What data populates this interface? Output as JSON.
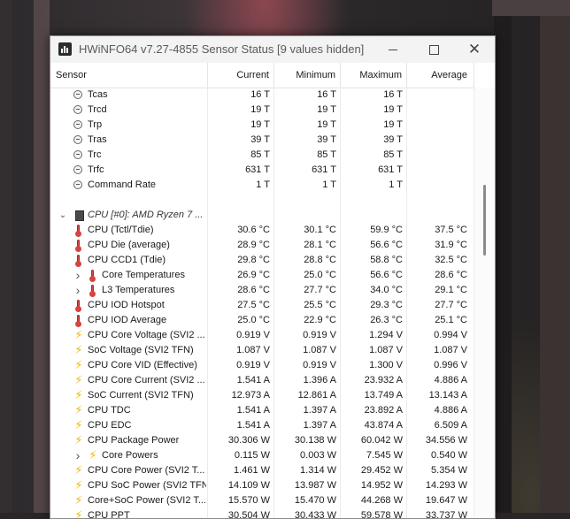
{
  "window": {
    "title": "HWiNFO64 v7.27-4855 Sensor Status [9 values hidden]"
  },
  "columns": {
    "sensor": "Sensor",
    "current": "Current",
    "minimum": "Minimum",
    "maximum": "Maximum",
    "average": "Average"
  },
  "rows": [
    {
      "type": "timing",
      "name": "Tcas",
      "cur": "16 T",
      "min": "16 T",
      "max": "16 T",
      "avg": ""
    },
    {
      "type": "timing",
      "name": "Trcd",
      "cur": "19 T",
      "min": "19 T",
      "max": "19 T",
      "avg": ""
    },
    {
      "type": "timing",
      "name": "Trp",
      "cur": "19 T",
      "min": "19 T",
      "max": "19 T",
      "avg": ""
    },
    {
      "type": "timing",
      "name": "Tras",
      "cur": "39 T",
      "min": "39 T",
      "max": "39 T",
      "avg": ""
    },
    {
      "type": "timing",
      "name": "Trc",
      "cur": "85 T",
      "min": "85 T",
      "max": "85 T",
      "avg": ""
    },
    {
      "type": "timing",
      "name": "Trfc",
      "cur": "631 T",
      "min": "631 T",
      "max": "631 T",
      "avg": ""
    },
    {
      "type": "timing",
      "name": "Command Rate",
      "cur": "1 T",
      "min": "1 T",
      "max": "1 T",
      "avg": ""
    },
    {
      "type": "blank",
      "name": "",
      "cur": "",
      "min": "",
      "max": "",
      "avg": ""
    },
    {
      "type": "group",
      "name": "CPU [#0]: AMD Ryzen 7 ...",
      "cur": "",
      "min": "",
      "max": "",
      "avg": ""
    },
    {
      "type": "temp",
      "name": "CPU (Tctl/Tdie)",
      "cur": "30.6 °C",
      "min": "30.1 °C",
      "max": "59.9 °C",
      "avg": "37.5 °C"
    },
    {
      "type": "temp",
      "name": "CPU Die (average)",
      "cur": "28.9 °C",
      "min": "28.1 °C",
      "max": "56.6 °C",
      "avg": "31.9 °C"
    },
    {
      "type": "temp",
      "name": "CPU CCD1 (Tdie)",
      "cur": "29.8 °C",
      "min": "28.8 °C",
      "max": "58.8 °C",
      "avg": "32.5 °C"
    },
    {
      "type": "temp",
      "expand": true,
      "name": "Core Temperatures",
      "cur": "26.9 °C",
      "min": "25.0 °C",
      "max": "56.6 °C",
      "avg": "28.6 °C"
    },
    {
      "type": "temp",
      "expand": true,
      "name": "L3 Temperatures",
      "cur": "28.6 °C",
      "min": "27.7 °C",
      "max": "34.0 °C",
      "avg": "29.1 °C"
    },
    {
      "type": "temp",
      "name": "CPU IOD Hotspot",
      "cur": "27.5 °C",
      "min": "25.5 °C",
      "max": "29.3 °C",
      "avg": "27.7 °C"
    },
    {
      "type": "temp",
      "name": "CPU IOD Average",
      "cur": "25.0 °C",
      "min": "22.9 °C",
      "max": "26.3 °C",
      "avg": "25.1 °C"
    },
    {
      "type": "power",
      "name": "CPU Core Voltage (SVI2 ...",
      "cur": "0.919 V",
      "min": "0.919 V",
      "max": "1.294 V",
      "avg": "0.994 V"
    },
    {
      "type": "power",
      "name": "SoC Voltage (SVI2 TFN)",
      "cur": "1.087 V",
      "min": "1.087 V",
      "max": "1.087 V",
      "avg": "1.087 V"
    },
    {
      "type": "power",
      "name": "CPU Core VID (Effective)",
      "cur": "0.919 V",
      "min": "0.919 V",
      "max": "1.300 V",
      "avg": "0.996 V"
    },
    {
      "type": "power",
      "name": "CPU Core Current (SVI2 ...",
      "cur": "1.541 A",
      "min": "1.396 A",
      "max": "23.932 A",
      "avg": "4.886 A"
    },
    {
      "type": "power",
      "name": "SoC Current (SVI2 TFN)",
      "cur": "12.973 A",
      "min": "12.861 A",
      "max": "13.749 A",
      "avg": "13.143 A"
    },
    {
      "type": "power",
      "name": "CPU TDC",
      "cur": "1.541 A",
      "min": "1.397 A",
      "max": "23.892 A",
      "avg": "4.886 A"
    },
    {
      "type": "power",
      "name": "CPU EDC",
      "cur": "1.541 A",
      "min": "1.397 A",
      "max": "43.874 A",
      "avg": "6.509 A"
    },
    {
      "type": "power",
      "name": "CPU Package Power",
      "cur": "30.306 W",
      "min": "30.138 W",
      "max": "60.042 W",
      "avg": "34.556 W"
    },
    {
      "type": "power",
      "expand": true,
      "name": "Core Powers",
      "cur": "0.115 W",
      "min": "0.003 W",
      "max": "7.545 W",
      "avg": "0.540 W"
    },
    {
      "type": "power",
      "name": "CPU Core Power (SVI2 T...",
      "cur": "1.461 W",
      "min": "1.314 W",
      "max": "29.452 W",
      "avg": "5.354 W"
    },
    {
      "type": "power",
      "name": "CPU SoC Power (SVI2 TFN)",
      "cur": "14.109 W",
      "min": "13.987 W",
      "max": "14.952 W",
      "avg": "14.293 W"
    },
    {
      "type": "power",
      "name": "Core+SoC Power (SVI2 T...",
      "cur": "15.570 W",
      "min": "15.470 W",
      "max": "44.268 W",
      "avg": "19.647 W"
    },
    {
      "type": "power",
      "name": "CPU PPT",
      "cur": "30.504 W",
      "min": "30.433 W",
      "max": "59.578 W",
      "avg": "33.737 W"
    }
  ]
}
